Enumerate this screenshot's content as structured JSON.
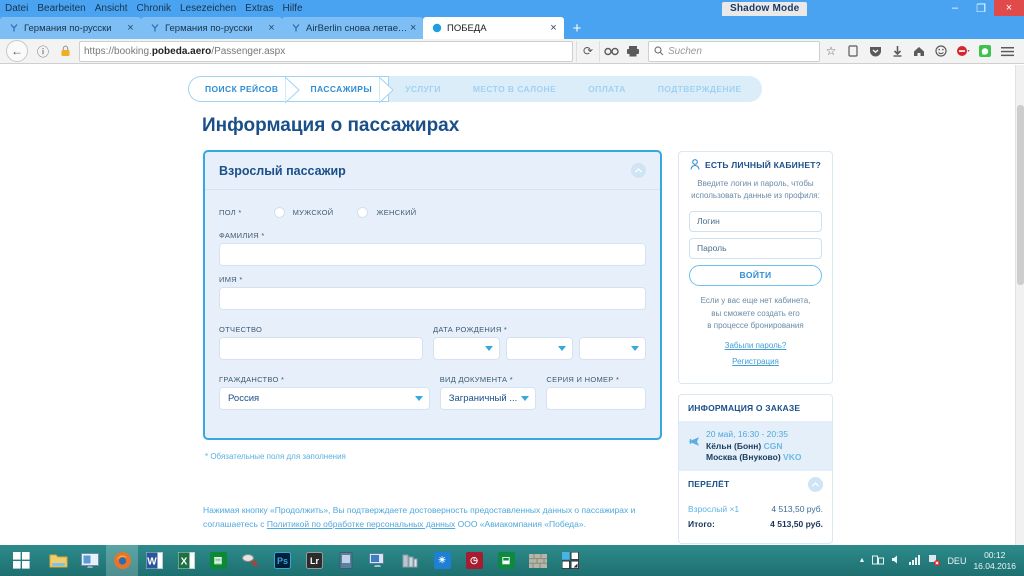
{
  "window": {
    "shadow_mode_badge": "Shadow Mode",
    "minimize": "–",
    "maximize": "❐",
    "close": "×"
  },
  "menubar": {
    "items": [
      "Datei",
      "Bearbeiten",
      "Ansicht",
      "Chronik",
      "Lesezeichen",
      "Extras",
      "Hilfe"
    ]
  },
  "tabs": [
    {
      "title": "Германия по-русски",
      "active": false
    },
    {
      "title": "Германия по-русски",
      "active": false
    },
    {
      "title": "AirBerlin снова летает в ...",
      "active": false
    },
    {
      "title": "ПОБЕДА",
      "active": true
    }
  ],
  "newtab_label": "+",
  "navbar": {
    "back_icon": "←",
    "info_icon": "ⓘ",
    "lock_icon": "lock-warning",
    "url_scheme": "https://booking.",
    "url_domain": "pobeda.aero",
    "url_path": "/Passenger.aspx",
    "reload_icon": "⟳",
    "search_placeholder": "Suchen",
    "icons": [
      "bookmark-star-icon",
      "reading-list-icon",
      "pocket-icon",
      "download-icon",
      "home-icon",
      "chat-icon",
      "adblock-icon",
      "whatsapp-icon",
      "menu-icon"
    ]
  },
  "steps": [
    {
      "label": "ПОИСК РЕЙСОВ",
      "state": "done"
    },
    {
      "label": "ПАССАЖИРЫ",
      "state": "current"
    },
    {
      "label": "УСЛУГИ",
      "state": "pending"
    },
    {
      "label": "МЕСТО В САЛОНЕ",
      "state": "pending"
    },
    {
      "label": "ОПЛАТА",
      "state": "pending"
    },
    {
      "label": "ПОДТВЕРЖДЕНИЕ",
      "state": "pending"
    }
  ],
  "page_title": "Информация о пассажирах",
  "passenger_card": {
    "heading": "Взрослый пассажир",
    "collapse_icon": "chevron-up-icon",
    "gender": {
      "label": "ПОЛ *",
      "options": [
        "МУЖСКОЙ",
        "ЖЕНСКИЙ"
      ],
      "selected": ""
    },
    "lastname": {
      "label": "ФАМИЛИЯ *",
      "value": ""
    },
    "firstname": {
      "label": "ИМЯ *",
      "value": ""
    },
    "middlename": {
      "label": "ОТЧЕСТВО",
      "value": ""
    },
    "dob": {
      "label": "ДАТА РОЖДЕНИЯ *",
      "day": "",
      "month": "",
      "year": ""
    },
    "citizenship": {
      "label": "ГРАЖДАНСТВО *",
      "value": "Россия"
    },
    "doctype": {
      "label": "ВИД ДОКУМЕНТА *",
      "value": "Заграничный ..."
    },
    "docnumber": {
      "label": "СЕРИЯ И НОМЕР *",
      "value": ""
    }
  },
  "required_note": "* Обязательные поля для заполнения",
  "legal": {
    "line1": "Нажимая кнопку «Продолжить», Вы подтверждаете достоверность предоставленных данных о пассажирах и",
    "line2_pre": "соглашаетесь с ",
    "line2_link": "Политикой по обработке персональных данных",
    "line2_post": " ООО «Авиакомпания «Победа»."
  },
  "account_panel": {
    "icon": "user-icon",
    "title": "ЕСТЬ ЛИЧНЫЙ КАБИНЕТ?",
    "help_line1": "Введите логин и пароль, чтобы",
    "help_line2": "использовать данные из профиля:",
    "login_placeholder": "Логин",
    "password_placeholder": "Пароль",
    "submit_label": "ВОЙТИ",
    "note_line1": "Если у вас еще нет кабинета,",
    "note_line2": "вы сможете создать его",
    "note_line3": "в процессе бронирования",
    "forgot_link": "Забыли пароль?",
    "register_link": "Регистрация"
  },
  "order_panel": {
    "title": "ИНФОРМАЦИЯ О ЗАКАЗЕ",
    "flight": {
      "icon": "plane-icon",
      "datetime": "20 май, 16:30 - 20:35",
      "origin_city": "Кёльн (Бонн)",
      "origin_code": "CGN",
      "dest_city": "Москва (Внуково)",
      "dest_code": "VKO"
    },
    "fare": {
      "title": "ПЕРЕЛЁТ",
      "collapse_icon": "chevron-up-icon",
      "rows": [
        {
          "label": "Взрослый ×1",
          "value": "4 513,50 руб."
        }
      ],
      "total_label": "Итого:",
      "total_value": "4 513,50 руб."
    }
  },
  "taskbar": {
    "start_icon": "windows-start-icon",
    "items": [
      {
        "name": "file-explorer-icon",
        "glyph": "🗂",
        "color": "#f0c14b",
        "active": false
      },
      {
        "name": "remote-desktop-icon",
        "glyph": "🖥",
        "color": "#5b9bd5",
        "active": false
      },
      {
        "name": "firefox-icon",
        "glyph": "🦊",
        "color": "#e8742c",
        "active": true
      },
      {
        "name": "word-icon",
        "glyph": "W",
        "color": "#2b579a",
        "active": false
      },
      {
        "name": "excel-icon",
        "glyph": "X",
        "color": "#1d7044",
        "active": false
      },
      {
        "name": "calculator-icon",
        "glyph": "▦",
        "color": "#0a8a32",
        "active": false
      },
      {
        "name": "snipping-tool-icon",
        "glyph": "✂",
        "color": "#c0392b",
        "active": false
      },
      {
        "name": "photoshop-icon",
        "glyph": "Ps",
        "color": "#001e36",
        "active": false
      },
      {
        "name": "lightroom-icon",
        "glyph": "Lr",
        "color": "#2b2b2b",
        "active": false
      },
      {
        "name": "app-icon",
        "glyph": "▮",
        "color": "#4b6b8a",
        "active": false
      },
      {
        "name": "display-settings-icon",
        "glyph": "🖳",
        "color": "#4a7fb5",
        "active": false
      },
      {
        "name": "defrag-icon",
        "glyph": "▤",
        "color": "#88a8bf",
        "active": false
      },
      {
        "name": "brightness-icon",
        "glyph": "☀",
        "color": "#1e7fd4",
        "active": false
      },
      {
        "name": "alarm-clock-icon",
        "glyph": "⏰",
        "color": "#a81c30",
        "active": false
      },
      {
        "name": "store-icon",
        "glyph": "🛍",
        "color": "#0c8a3e",
        "active": false
      },
      {
        "name": "firewall-icon",
        "glyph": "▩",
        "color": "#9a9a92",
        "active": false
      },
      {
        "name": "tiles-icon",
        "glyph": "◩",
        "color": "#49b3e8",
        "active": false
      }
    ],
    "tray": {
      "expand_icon": "▲",
      "network_icon": "network-icon",
      "volume_icon": "volume-icon",
      "signal_icon": "signal-icon",
      "flag_icon": "action-center-icon",
      "language": "DEU",
      "time": "00:12",
      "date": "16.04.2016"
    }
  },
  "colors": {
    "accent_blue": "#35a8e0",
    "dark_blue": "#1a4f8a",
    "card_bg": "#e7f0fa",
    "titlebar": "#4aa3f0",
    "taskbar": "#2e8b8b"
  }
}
